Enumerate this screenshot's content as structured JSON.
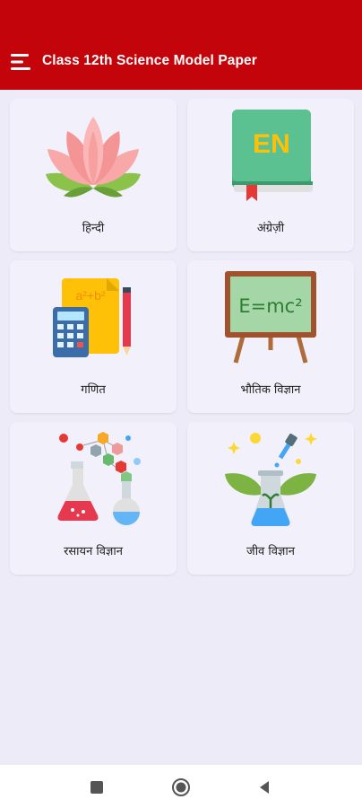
{
  "appbar": {
    "title": "Class 12th Science Model Paper",
    "menu_icon": "hamburger-menu-icon",
    "color": "#c4040b"
  },
  "subjects": [
    {
      "label": "हिन्दी",
      "icon": "lotus-icon"
    },
    {
      "label": "अंग्रेज़ी",
      "icon": "english-book-icon"
    },
    {
      "label": "गणित",
      "icon": "calculator-math-icon"
    },
    {
      "label": "भौतिक विज्ञान",
      "icon": "blackboard-emc2-icon"
    },
    {
      "label": "रसायन विज्ञान",
      "icon": "chemistry-flask-icon"
    },
    {
      "label": "जीव विज्ञान",
      "icon": "biology-beaker-icon"
    }
  ],
  "illustration_text": {
    "en": "EN",
    "formula": "E=mc²",
    "math": "a²+b²"
  },
  "navbar": {
    "items": [
      "recents-square-icon",
      "home-circle-icon",
      "back-triangle-icon"
    ]
  }
}
